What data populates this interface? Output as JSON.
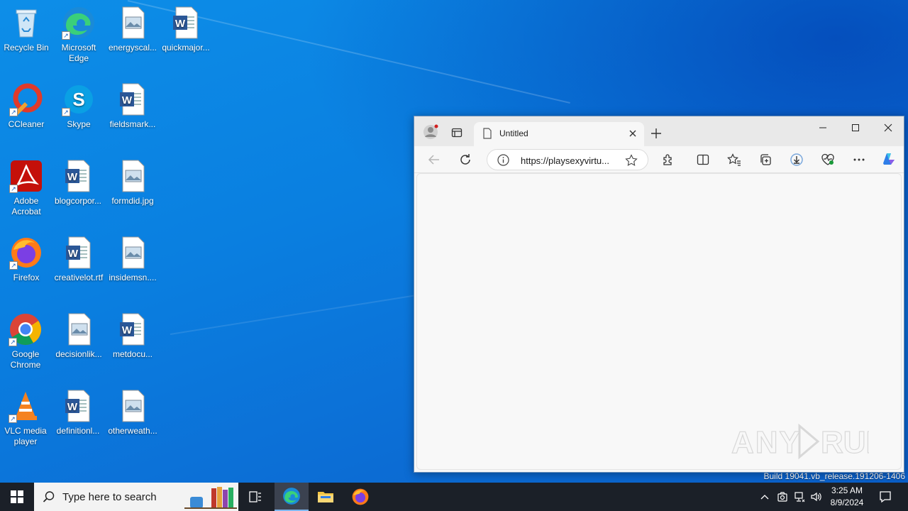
{
  "desktop": {
    "icons": [
      {
        "label": "Recycle Bin",
        "icon": "recycle-bin-icon"
      },
      {
        "label": "Microsoft Edge",
        "icon": "edge-icon"
      },
      {
        "label": "energyscal...",
        "icon": "image-file-icon"
      },
      {
        "label": "quickmajor...",
        "icon": "word-doc-icon"
      },
      {
        "label": "CCleaner",
        "icon": "ccleaner-icon"
      },
      {
        "label": "Skype",
        "icon": "skype-icon"
      },
      {
        "label": "fieldsmark...",
        "icon": "word-doc-icon"
      },
      {
        "label": "Adobe Acrobat",
        "icon": "acrobat-icon"
      },
      {
        "label": "blogcorpor...",
        "icon": "word-doc-icon"
      },
      {
        "label": "formdid.jpg",
        "icon": "image-file-icon"
      },
      {
        "label": "Firefox",
        "icon": "firefox-icon"
      },
      {
        "label": "creativelot.rtf",
        "icon": "word-doc-icon"
      },
      {
        "label": "insidemsn....",
        "icon": "image-file-icon"
      },
      {
        "label": "Google Chrome",
        "icon": "chrome-icon"
      },
      {
        "label": "decisionlik...",
        "icon": "image-file-icon"
      },
      {
        "label": "metdocu...",
        "icon": "word-doc-icon"
      },
      {
        "label": "VLC media player",
        "icon": "vlc-icon"
      },
      {
        "label": "definitionl...",
        "icon": "word-doc-icon"
      },
      {
        "label": "otherweath...",
        "icon": "image-file-icon"
      }
    ]
  },
  "browser": {
    "tab_title": "Untitled",
    "url": "https://playsexyvirtu...",
    "window_controls": [
      "minimize",
      "maximize",
      "close"
    ],
    "watermark": "ANY RUN"
  },
  "build_text": "Build 19041.vb_release.191206-1406",
  "taskbar": {
    "search_placeholder": "Type here to search",
    "time": "3:25 AM",
    "date": "8/9/2024"
  },
  "colors": {
    "desktop": "#0a78d7",
    "taskbar": "#1b2028",
    "edge_accent": "#1a73e8"
  }
}
